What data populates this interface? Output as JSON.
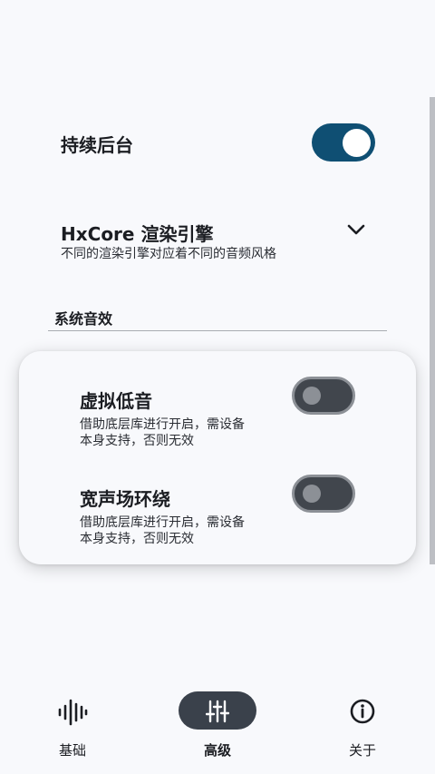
{
  "settings": {
    "keep_background": {
      "title": "持续后台",
      "enabled": true
    },
    "render_engine": {
      "title": "HxCore 渲染引擎",
      "description": "不同的渲染引擎对应着不同的音频风格"
    },
    "system_effects_header": "系统音效"
  },
  "effects_card": {
    "virtual_bass": {
      "title": "虚拟低音",
      "description_line1": "借助底层库进行开启，需设备",
      "description_line2": "本身支持，否则无效",
      "enabled": false
    },
    "surround": {
      "title": "宽声场环绕",
      "description_line1": "借助底层库进行开启，需设备",
      "description_line2": "本身支持，否则无效",
      "enabled": false
    }
  },
  "bottom_nav": {
    "items": [
      {
        "label": "基础",
        "icon": "waveform-icon"
      },
      {
        "label": "高级",
        "icon": "sliders-icon",
        "selected": true
      },
      {
        "label": "关于",
        "icon": "info-icon"
      }
    ]
  },
  "colors": {
    "accent": "#0f4f73",
    "switch_off": "#41464d",
    "nav_selected": "#3a414b",
    "background": "#f8f9fc"
  }
}
